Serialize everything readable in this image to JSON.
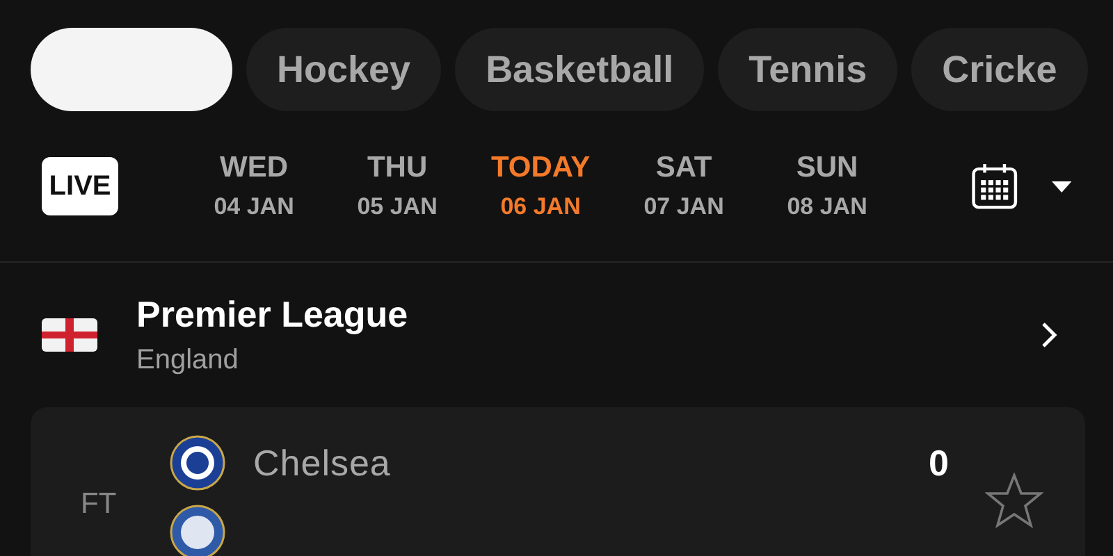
{
  "sport_tabs": [
    {
      "selected": true
    },
    {
      "label": "Hockey",
      "selected": false
    },
    {
      "label": "Basketball",
      "selected": false
    },
    {
      "label": "Tennis",
      "selected": false
    },
    {
      "label": "Cricke",
      "selected": false
    }
  ],
  "live_button": "LIVE",
  "days": [
    {
      "day": "WED",
      "date": "04 JAN",
      "selected": false
    },
    {
      "day": "THU",
      "date": "05 JAN",
      "selected": false
    },
    {
      "day": "TODAY",
      "date": "06 JAN",
      "selected": true
    },
    {
      "day": "SAT",
      "date": "07 JAN",
      "selected": false
    },
    {
      "day": "SUN",
      "date": "08 JAN",
      "selected": false
    }
  ],
  "league": {
    "name": "Premier League",
    "country": "England"
  },
  "match": {
    "status": "FT",
    "home": {
      "team": "Chelsea",
      "score": "0"
    },
    "favorite": false
  }
}
